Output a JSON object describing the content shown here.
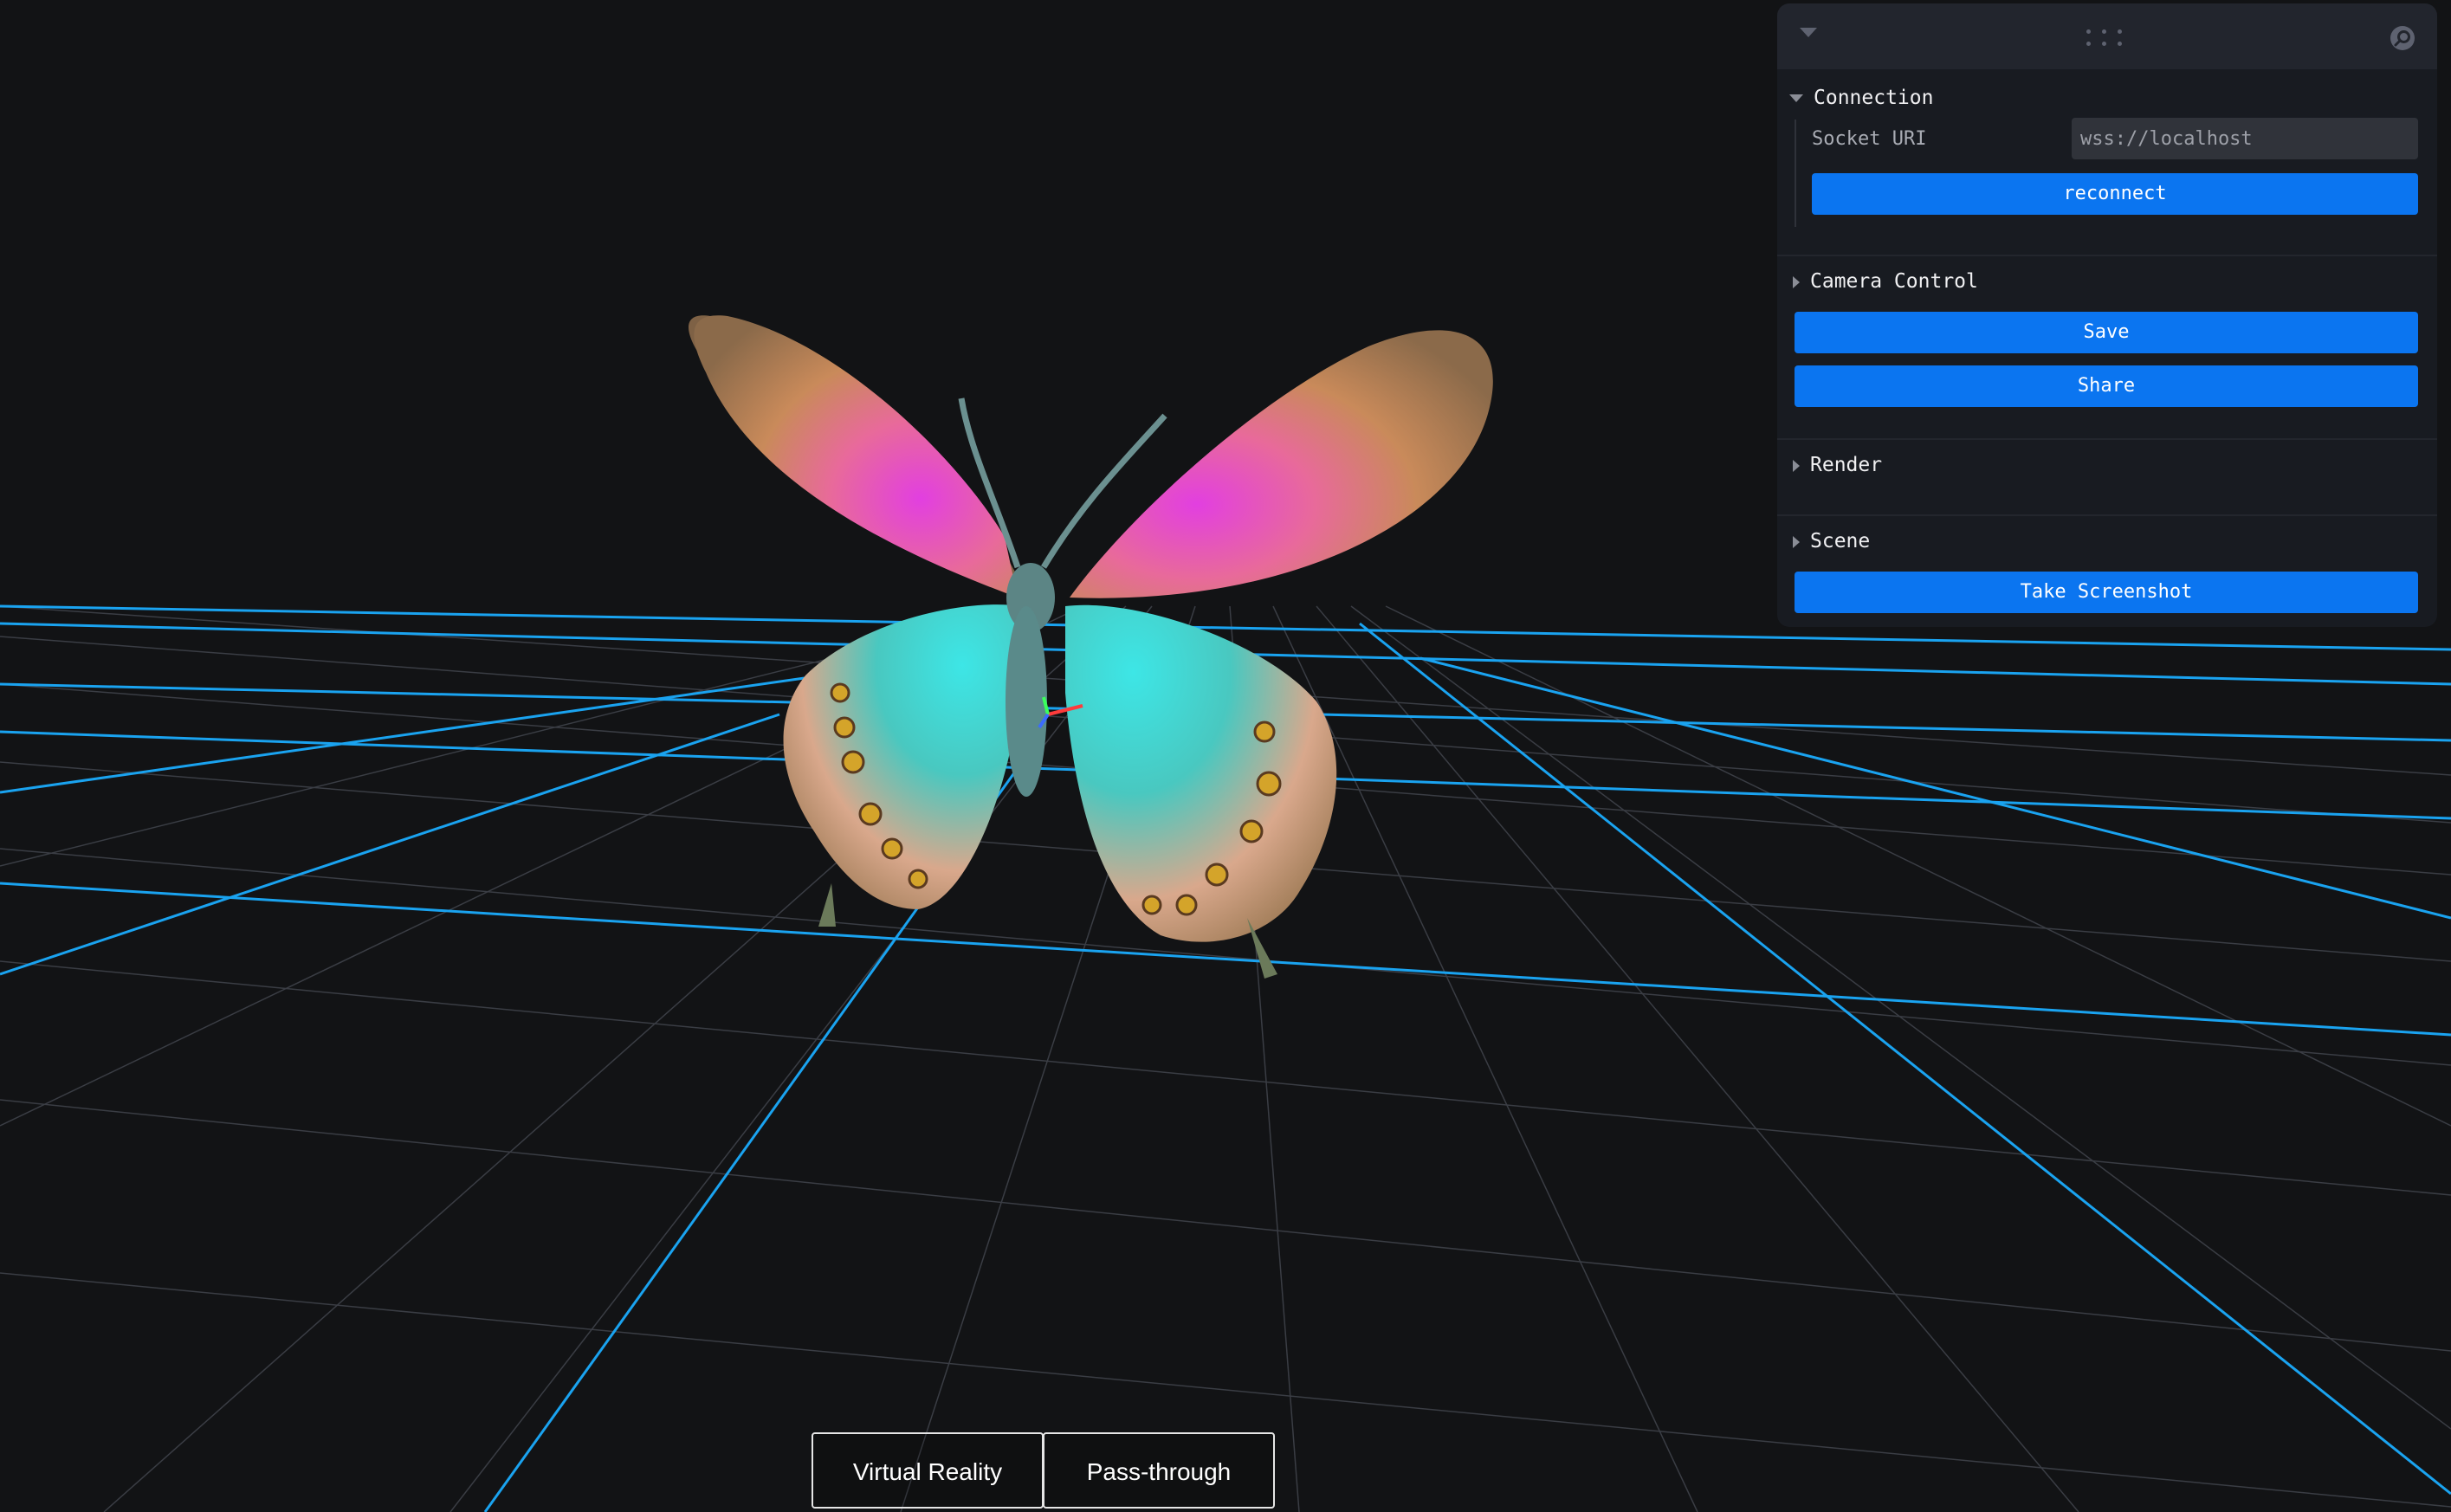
{
  "panel": {
    "connection": {
      "title": "Connection",
      "socket_label": "Socket URI",
      "socket_value": "wss://localhost",
      "reconnect_label": "reconnect"
    },
    "camera_control": {
      "title": "Camera Control",
      "save_label": "Save",
      "share_label": "Share"
    },
    "render": {
      "title": "Render"
    },
    "scene": {
      "title": "Scene",
      "screenshot_label": "Take Screenshot"
    }
  },
  "xr": {
    "vr_label": "Virtual Reality",
    "passthrough_label": "Pass-through"
  },
  "colors": {
    "grid_major": "#1aa3f0",
    "grid_minor": "#3a3d44",
    "button": "#0b75f0",
    "panel_bg": "#181b21"
  },
  "icons": [
    "chevron-down-icon",
    "drag-handle-icon",
    "search-icon"
  ]
}
